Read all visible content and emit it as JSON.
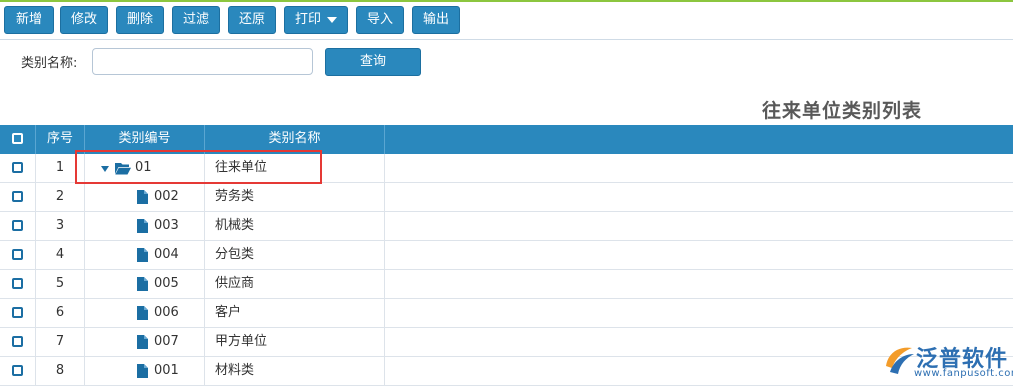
{
  "toolbar": {
    "buttons": [
      {
        "id": "new",
        "label": "新增"
      },
      {
        "id": "edit",
        "label": "修改"
      },
      {
        "id": "delete",
        "label": "删除"
      },
      {
        "id": "filter",
        "label": "过滤"
      },
      {
        "id": "restore",
        "label": "还原"
      },
      {
        "id": "print",
        "label": "打印"
      },
      {
        "id": "import",
        "label": "导入"
      },
      {
        "id": "export",
        "label": "输出"
      }
    ]
  },
  "search": {
    "label": "类别名称:",
    "value": "",
    "query_label": "查询"
  },
  "page_title": "往来单位类别列表",
  "grid": {
    "columns": [
      "序号",
      "类别编号",
      "类别名称"
    ],
    "rows": [
      {
        "seq": "1",
        "code": "01",
        "name": "往来单位",
        "node": "folder-expanded"
      },
      {
        "seq": "2",
        "code": "002",
        "name": "劳务类",
        "node": "file"
      },
      {
        "seq": "3",
        "code": "003",
        "name": "机械类",
        "node": "file"
      },
      {
        "seq": "4",
        "code": "004",
        "name": "分包类",
        "node": "file"
      },
      {
        "seq": "5",
        "code": "005",
        "name": "供应商",
        "node": "file"
      },
      {
        "seq": "6",
        "code": "006",
        "name": "客户",
        "node": "file"
      },
      {
        "seq": "7",
        "code": "007",
        "name": "甲方单位",
        "node": "file"
      },
      {
        "seq": "8",
        "code": "001",
        "name": "材料类",
        "node": "file"
      }
    ]
  },
  "logo": {
    "text": "泛普软件",
    "url": "www.fanpusoft.com"
  },
  "colors": {
    "accent": "#2a88bd",
    "highlight": "#e53935",
    "top_bar": "#8cc63f"
  }
}
